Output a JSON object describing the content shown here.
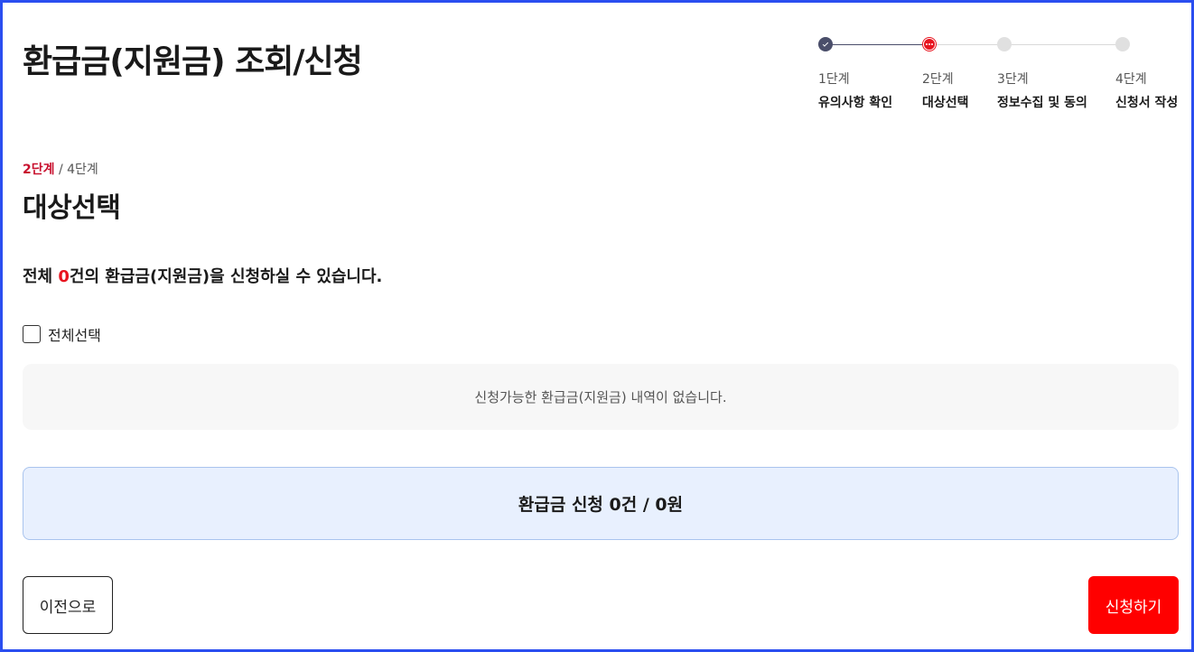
{
  "header": {
    "title": "환급금(지원금) 조회/신청"
  },
  "stepper": {
    "steps": [
      {
        "num": "1단계",
        "name": "유의사항 확인",
        "state": "done"
      },
      {
        "num": "2단계",
        "name": "대상선택",
        "state": "current"
      },
      {
        "num": "3단계",
        "name": "정보수집 및 동의",
        "state": "todo"
      },
      {
        "num": "4단계",
        "name": "신청서 작성",
        "state": "todo"
      }
    ]
  },
  "section": {
    "current_step": "2단계",
    "total_steps": "/ 4단계",
    "title": "대상선택"
  },
  "summary": {
    "prefix": "전체 ",
    "count": "0",
    "suffix": "건의 환급금(지원금)을 신청하실 수 있습니다."
  },
  "select_all": {
    "label": "전체선택",
    "checked": false
  },
  "empty_message": "신청가능한 환급금(지원금) 내역이 없습니다.",
  "total": {
    "text": "환급금 신청 0건 / 0원"
  },
  "buttons": {
    "prev": "이전으로",
    "apply": "신청하기"
  },
  "colors": {
    "accent": "#e8141f",
    "apply_button": "#ff0000",
    "step_done": "#4a4e6a",
    "total_bg": "#e8f0fe"
  }
}
